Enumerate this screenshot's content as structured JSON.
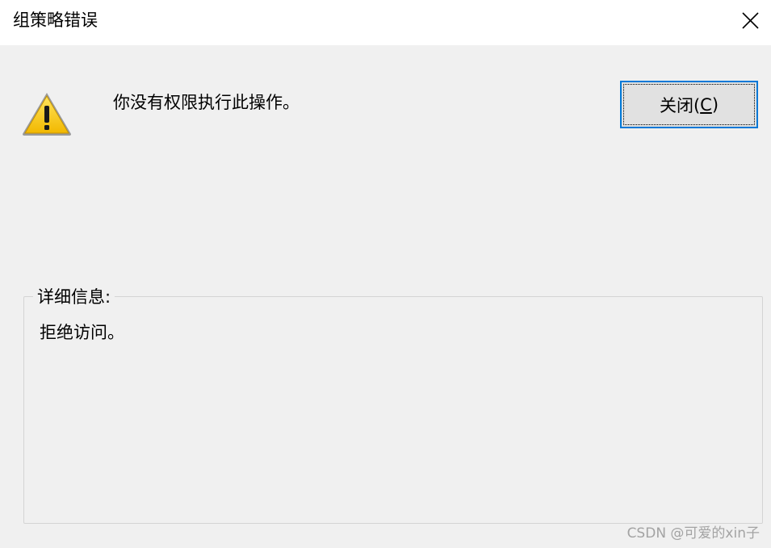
{
  "window": {
    "title": "组策略错误"
  },
  "dialog": {
    "icon": "warning-icon",
    "message": "你没有权限执行此操作。",
    "close_button": {
      "label_prefix": "关闭(",
      "mnemonic": "C",
      "label_suffix": ")"
    }
  },
  "details": {
    "label": "详细信息:",
    "text": "拒绝访问。"
  },
  "watermark": "CSDN @可爱的xin子",
  "colors": {
    "focus_border": "#0078d7",
    "background": "#f0f0f0",
    "warning_yellow": "#f5c400"
  }
}
